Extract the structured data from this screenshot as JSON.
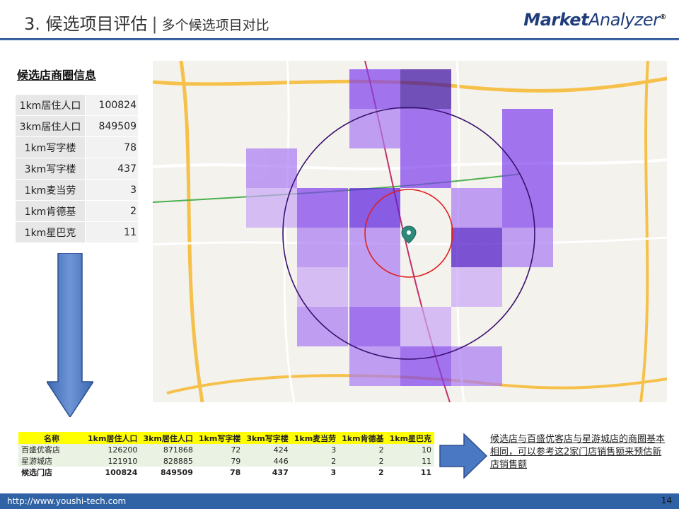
{
  "header": {
    "title_main": "3. 候选项目评估",
    "separator": "|",
    "title_sub": "多个候选项目对比",
    "brand_bold": "Market",
    "brand_light": "Analyzer",
    "brand_mark": "®"
  },
  "info": {
    "title": "候选店商圈信息",
    "rows": [
      {
        "label": "1km居住人口",
        "value": "100824"
      },
      {
        "label": "3km居住人口",
        "value": "849509"
      },
      {
        "label": "1km写字楼",
        "value": "78"
      },
      {
        "label": "3km写字楼",
        "value": "437"
      },
      {
        "label": "1km麦当劳",
        "value": "3"
      },
      {
        "label": "1km肯德基",
        "value": "2"
      },
      {
        "label": "1km星巴克",
        "value": "11"
      }
    ]
  },
  "comparison": {
    "headers": [
      "名称",
      "1km居住人口",
      "3km居住人口",
      "1km写字楼",
      "3km写字楼",
      "1km麦当劳",
      "1km肯德基",
      "1km星巴克"
    ],
    "rows": [
      [
        "百盛优客店",
        "126200",
        "871868",
        "72",
        "424",
        "3",
        "2",
        "10"
      ],
      [
        "星游城店",
        "121910",
        "828885",
        "79",
        "446",
        "2",
        "2",
        "11"
      ],
      [
        "候选门店",
        "100824",
        "849509",
        "78",
        "437",
        "3",
        "2",
        "11"
      ]
    ]
  },
  "conclusion": "候选店与百盛优客店与星游城店的商圈基本相同，可以参考这2家门店销售额来预估新店销售额",
  "footer": {
    "url": "http://www.youshi-tech.com",
    "page": "14"
  },
  "colors": {
    "accent": "#2f63a6",
    "arrow": "#4a78c2",
    "highlight": "#ffff00",
    "inner_ring": "#e02020",
    "outer_ring": "#3a1070"
  }
}
